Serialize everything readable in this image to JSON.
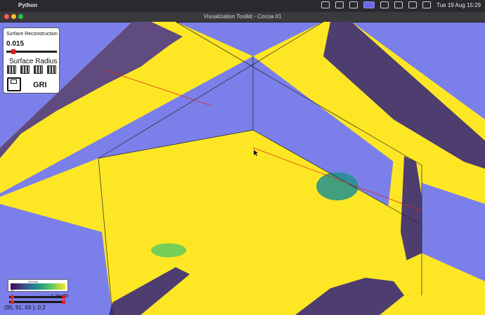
{
  "menubar": {
    "app_name": "Python",
    "clock": "Tue 19 Aug  15:29",
    "tray_icons": [
      "display-icon",
      "dropbox-icon",
      "screen-icon",
      "status-icon",
      "battery-icon",
      "wifi-icon",
      "search-icon",
      "control-center-icon"
    ]
  },
  "window": {
    "title": "Visualization Toolkit - Cocoa #1"
  },
  "panel": {
    "title": "Surface Reconstruction",
    "value": "0.015",
    "radius_label": "Surface Radius",
    "button_label": "GRI",
    "slider_fraction": 0.1
  },
  "colorbar": {
    "title": "Overlay",
    "min_label": "0"
  },
  "window_level": {
    "label": "1.7e+00"
  },
  "probe": {
    "text": "(95, 91, 63 ): 0.2"
  },
  "colors": {
    "background": "#7b7fe9",
    "slice": "#fde725",
    "edge": "#440154"
  }
}
